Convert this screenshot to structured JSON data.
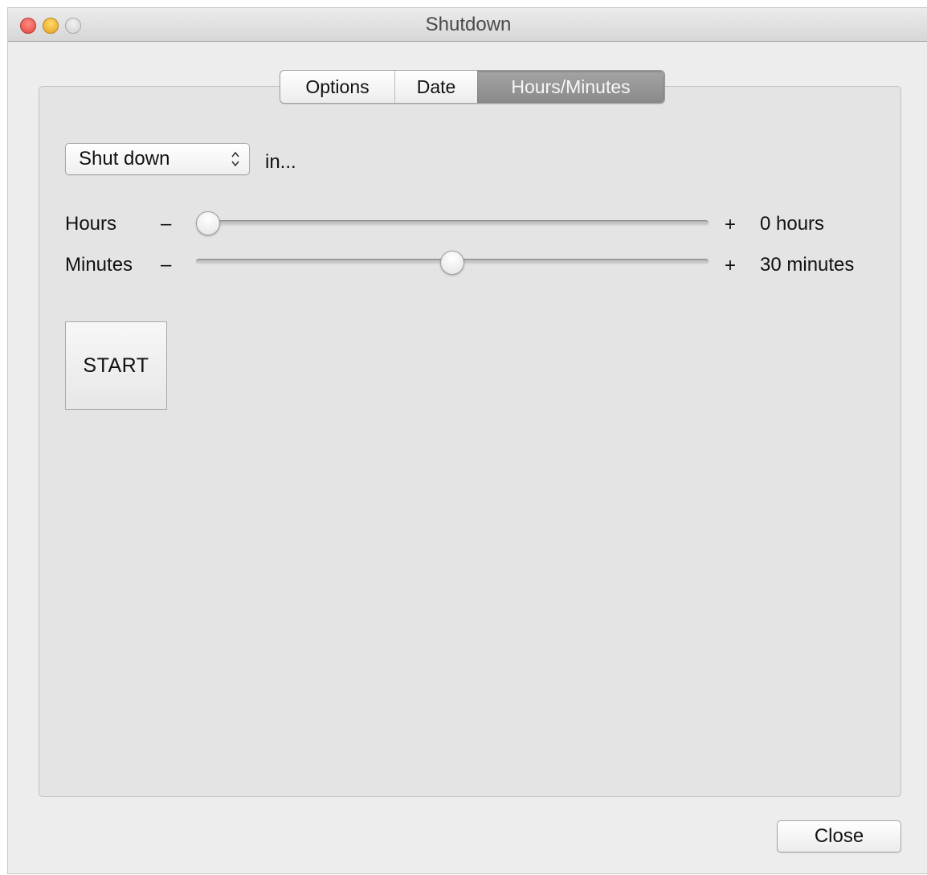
{
  "window": {
    "title": "Shutdown"
  },
  "tabs": [
    {
      "label": "Options",
      "selected": false
    },
    {
      "label": "Date",
      "selected": false
    },
    {
      "label": "Hours/Minutes",
      "selected": true
    }
  ],
  "action": {
    "selected_value": "Shut down",
    "suffix": "in..."
  },
  "sliders": {
    "hours": {
      "label": "Hours",
      "minus": "–",
      "plus": "+",
      "value_label": "0 hours",
      "value": 0,
      "fraction": 0.0
    },
    "minutes": {
      "label": "Minutes",
      "minus": "–",
      "plus": "+",
      "value_label": "30 minutes",
      "value": 30,
      "fraction": 0.5
    }
  },
  "buttons": {
    "start": "START",
    "close": "Close"
  },
  "icons": {
    "close": "close-window-icon",
    "minimize": "minimize-window-icon",
    "zoom": "zoom-window-icon",
    "select_arrows": "updown-chevron-icon"
  }
}
